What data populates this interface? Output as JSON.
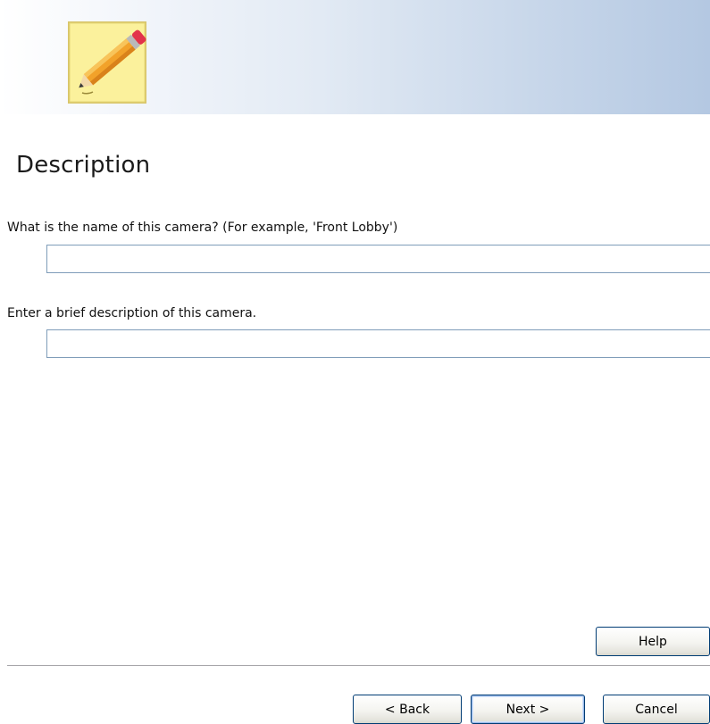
{
  "header": {
    "icon": "pencil-note-icon"
  },
  "main": {
    "title": "Description",
    "name_field": {
      "label": "What is the name of this camera? (For example, 'Front Lobby')",
      "value": "",
      "placeholder": ""
    },
    "description_field": {
      "label": "Enter a brief description of this camera.",
      "value": "",
      "placeholder": ""
    }
  },
  "buttons": {
    "help": "Help",
    "back": "< Back",
    "next": "Next >",
    "cancel": "Cancel"
  },
  "colors": {
    "banner_end": "#b4c8e2",
    "field_border": "#7f9db9",
    "button_border": "#003c74"
  }
}
